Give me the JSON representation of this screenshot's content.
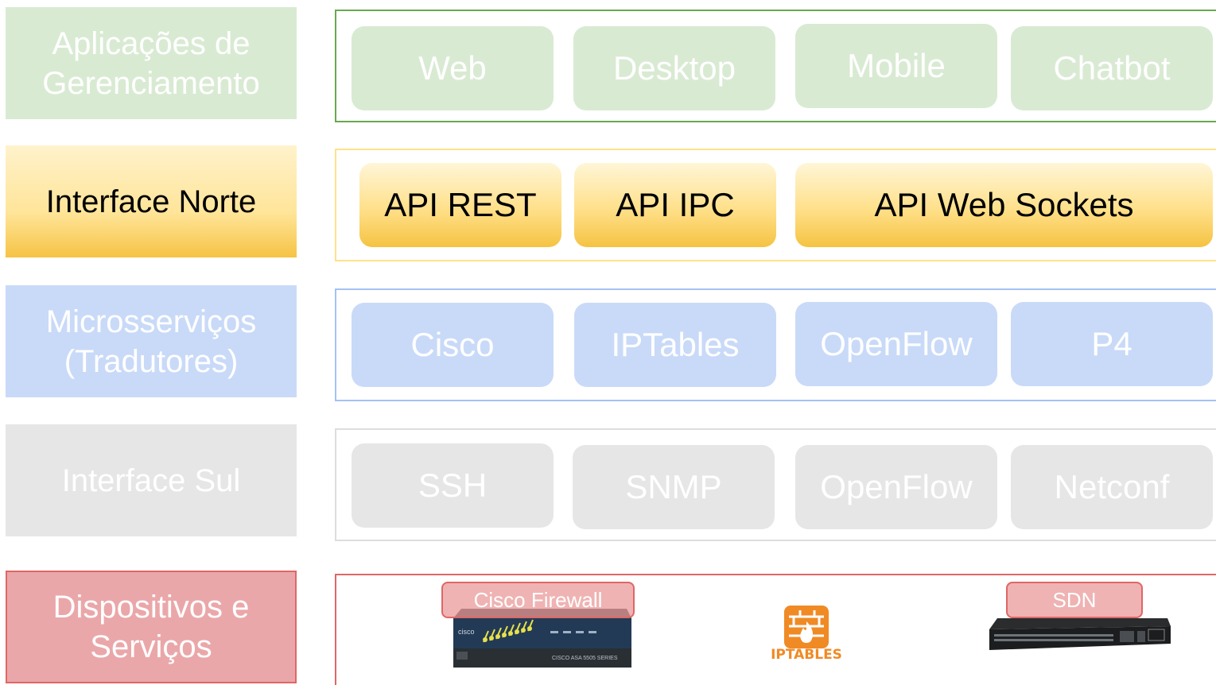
{
  "layers": [
    {
      "label": "Aplicações de\nGerenciamento",
      "items": [
        "Web",
        "Desktop",
        "Mobile",
        "Chatbot"
      ]
    },
    {
      "label": "Interface Norte",
      "items": [
        "API REST",
        "API IPC",
        "API Web Sockets"
      ]
    },
    {
      "label": "Microsserviços\n(Tradutores)",
      "items": [
        "Cisco",
        "IPTables",
        "OpenFlow",
        "P4"
      ]
    },
    {
      "label": "Interface Sul",
      "items": [
        "SSH",
        "SNMP",
        "OpenFlow",
        "Netconf"
      ]
    },
    {
      "label": "Dispositivos e\nServiços",
      "devices": [
        {
          "label": "Cisco Firewall",
          "icon": "cisco-firewall-appliance"
        },
        {
          "logo_text": "IPTABLES",
          "icon": "iptables-firewall-icon"
        },
        {
          "label": "SDN",
          "icon": "sdn-switch"
        }
      ]
    }
  ],
  "device_texts": {
    "cisco_brand": "cisco",
    "cisco_model": "CISCO ASA 5505 SERIES"
  },
  "colors": {
    "green": "#d9ead3",
    "yellow": "#ffe599",
    "blue": "#c9daf8",
    "gray": "#e6e6e6",
    "red": "#eaa7a9",
    "iptables_orange": "#f08a24"
  }
}
